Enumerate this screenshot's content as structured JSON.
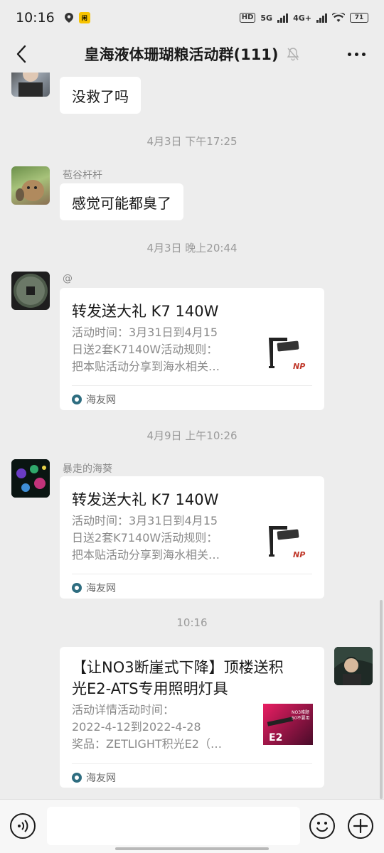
{
  "status_bar": {
    "time": "10:16",
    "app_badge": "闲",
    "hd_label": "HD",
    "net1": "5G",
    "net2": "4G+",
    "battery": "71"
  },
  "header": {
    "title": "皇海液体珊瑚粮活动群(111)",
    "back_icon": "chevron-left-icon",
    "mute_icon": "bell-off-icon",
    "more_icon": "more-dots-icon"
  },
  "messages": {
    "m1": {
      "text": "没救了吗"
    },
    "ts1": "4月3日 下午17:25",
    "m2": {
      "sender": "苞谷杆杆",
      "text": "感觉可能都臭了"
    },
    "ts2": "4月3日 晚上20:44",
    "m3": {
      "sender": "@",
      "title": "转发送大礼 K7 140W",
      "desc": "活动时间：3月31日到4月15\n日送2套K7140W活动规则：\n把本贴活动分享到海水相关…",
      "source": "海友网",
      "thumb_text": "NP"
    },
    "ts3": "4月9日 上午10:26",
    "m4": {
      "sender": "暴走的海葵",
      "title": "转发送大礼 K7 140W",
      "desc": "活动时间：3月31日到4月15\n日送2套K7140W活动规则：\n把本贴活动分享到海水相关…",
      "source": "海友网",
      "thumb_text": "NP"
    },
    "ts4": "10:16",
    "m5": {
      "title": "【让NO3断崖式下降】顶楼送积光E2-ATS专用照明灯具",
      "title_line1": "【让NO3断崖式下降】顶楼送积",
      "title_line2": "光E2-ATS专用照明灯具",
      "desc": "活动详情活动时间：\n2022-4-12到2022-4-28\n奖品：ZETLIGHT积光E2（…",
      "source": "海友网",
      "thumb_text": "E2",
      "thumb_text2": "NO3难题\n50不要用"
    }
  },
  "input_bar": {
    "placeholder": "",
    "voice_icon": "voice-icon",
    "emoji_icon": "emoji-icon",
    "plus_icon": "plus-icon"
  }
}
